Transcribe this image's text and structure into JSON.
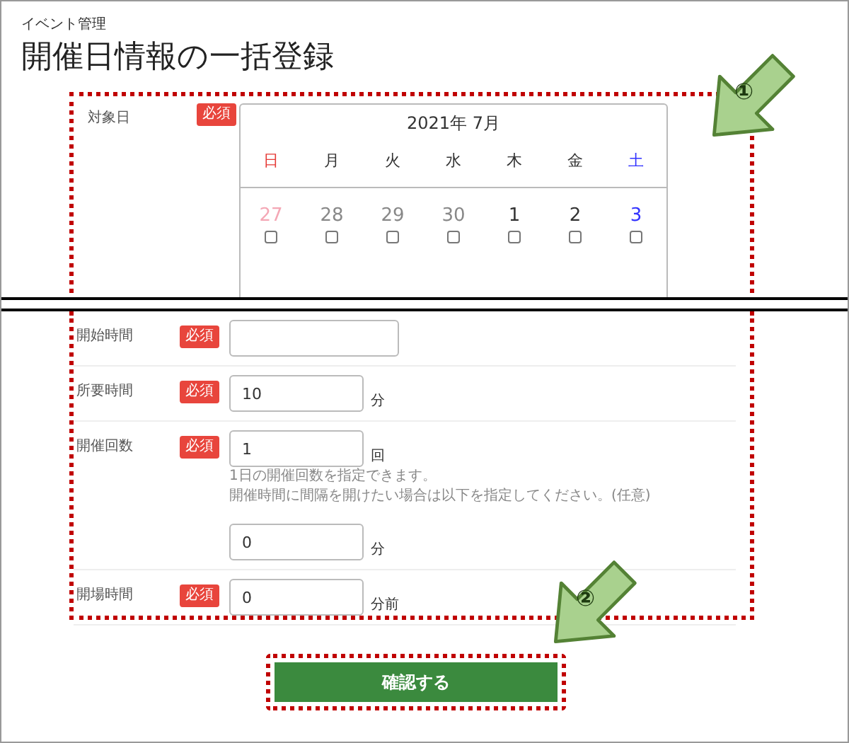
{
  "breadcrumb": "イベント管理",
  "title": "開催日情報の一括登録",
  "date_field": {
    "label": "対象日",
    "badge": "必須",
    "month": "2021年 7月",
    "weekdays": [
      "日",
      "月",
      "火",
      "水",
      "木",
      "金",
      "土"
    ],
    "days": [
      {
        "day": "27",
        "outside": true,
        "checked": false
      },
      {
        "day": "28",
        "outside": true,
        "checked": false
      },
      {
        "day": "29",
        "outside": true,
        "checked": false
      },
      {
        "day": "30",
        "outside": true,
        "checked": false
      },
      {
        "day": "1",
        "outside": false,
        "checked": false
      },
      {
        "day": "2",
        "outside": false,
        "checked": false
      },
      {
        "day": "3",
        "outside": false,
        "checked": false
      }
    ]
  },
  "fields": [
    {
      "label": "開始時間",
      "badge": "必須",
      "wide": true
    },
    {
      "label": "所要時間",
      "badge": "必須",
      "wide": false,
      "value": "10",
      "unit": "分"
    },
    {
      "label": "開催回数",
      "badge": "必須",
      "wide": false,
      "value": "1",
      "unit": "回",
      "notes": [
        "1日の開催回数を指定できます。",
        "開催時間に間隔を開けたい場合は以下を指定してください。(任意)"
      ],
      "extra": {
        "value": "0",
        "unit": "分"
      }
    },
    {
      "label": "開場時間",
      "badge": "必須",
      "wide": false,
      "value": "0",
      "unit": "分前"
    }
  ],
  "confirm_button": "確認する",
  "callouts": [
    "①",
    "②"
  ]
}
